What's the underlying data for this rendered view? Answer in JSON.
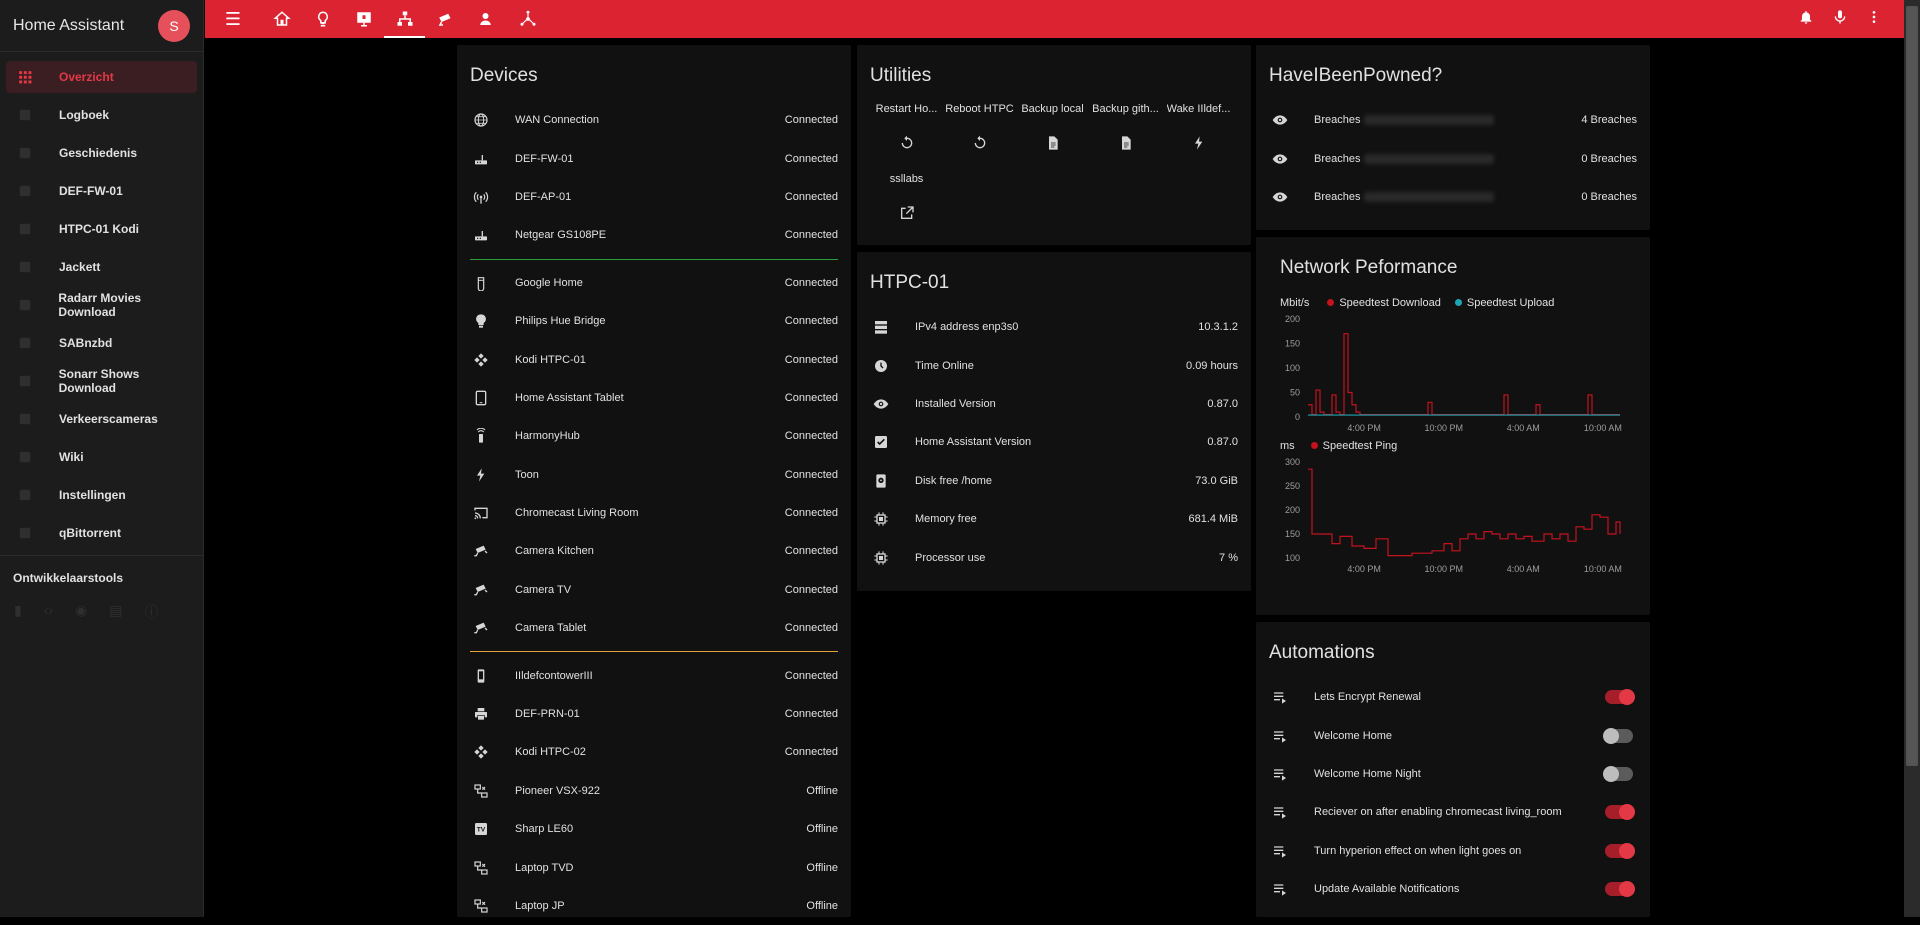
{
  "app": {
    "title": "Home Assistant",
    "avatar_letter": "S"
  },
  "sidebar": {
    "items": [
      {
        "label": "Overzicht",
        "icon": "grid-icon",
        "active": true
      },
      {
        "label": "Logboek",
        "icon": "list-icon"
      },
      {
        "label": "Geschiedenis",
        "icon": "chart-icon"
      },
      {
        "label": "DEF-FW-01",
        "icon": "router-icon"
      },
      {
        "label": "HTPC-01 Kodi",
        "icon": "kodi-icon"
      },
      {
        "label": "Jackett",
        "icon": "bag-icon"
      },
      {
        "label": "Radarr Movies Download",
        "icon": "movie-icon"
      },
      {
        "label": "SABnzbd",
        "icon": "download-icon"
      },
      {
        "label": "Sonarr Shows Download",
        "icon": "tv-icon"
      },
      {
        "label": "Verkeerscameras",
        "icon": "camera-icon"
      },
      {
        "label": "Wiki",
        "icon": "wiki-icon"
      },
      {
        "label": "Instellingen",
        "icon": "gear-icon"
      },
      {
        "label": "qBittorrent",
        "icon": "torrent-icon"
      }
    ],
    "developer_title": "Ontwikkelaarstools"
  },
  "colors": {
    "accent": "#dc2332",
    "toggle_on": "#e33947",
    "download": "#c4131f",
    "upload": "#1ca5b4",
    "green_sep": "#2e9c3a",
    "orange_sep": "#e6a23c"
  },
  "devices": {
    "title": "Devices",
    "groups": [
      [
        {
          "name": "WAN Connection",
          "state": "Connected",
          "icon": "globe-icon"
        },
        {
          "name": "DEF-FW-01",
          "state": "Connected",
          "icon": "router-icon"
        },
        {
          "name": "DEF-AP-01",
          "state": "Connected",
          "icon": "access-point-icon"
        },
        {
          "name": "Netgear GS108PE",
          "state": "Connected",
          "icon": "router-icon"
        }
      ],
      [
        {
          "name": "Google Home",
          "state": "Connected",
          "icon": "speaker-icon"
        },
        {
          "name": "Philips Hue Bridge",
          "state": "Connected",
          "icon": "bulb-icon"
        },
        {
          "name": "Kodi HTPC-01",
          "state": "Connected",
          "icon": "kodi-icon"
        },
        {
          "name": "Home Assistant Tablet",
          "state": "Connected",
          "icon": "tablet-icon"
        },
        {
          "name": "HarmonyHub",
          "state": "Connected",
          "icon": "remote-icon"
        },
        {
          "name": "Toon",
          "state": "Connected",
          "icon": "flash-icon"
        },
        {
          "name": "Chromecast Living Room",
          "state": "Connected",
          "icon": "cast-icon"
        },
        {
          "name": "Camera Kitchen",
          "state": "Connected",
          "icon": "cctv-icon"
        },
        {
          "name": "Camera TV",
          "state": "Connected",
          "icon": "cctv-icon"
        },
        {
          "name": "Camera Tablet",
          "state": "Connected",
          "icon": "cctv-icon"
        }
      ],
      [
        {
          "name": "IIldefcontowerIII",
          "state": "Connected",
          "icon": "cellphone-icon"
        },
        {
          "name": "DEF-PRN-01",
          "state": "Connected",
          "icon": "printer-icon"
        },
        {
          "name": "Kodi HTPC-02",
          "state": "Connected",
          "icon": "kodi-icon"
        },
        {
          "name": "Pioneer VSX-922",
          "state": "Offline",
          "icon": "lan-disconnect-icon"
        },
        {
          "name": "Sharp LE60",
          "state": "Offline",
          "icon": "tv-box-icon"
        },
        {
          "name": "Laptop TVD",
          "state": "Offline",
          "icon": "lan-disconnect-icon"
        },
        {
          "name": "Laptop JP",
          "state": "Offline",
          "icon": "lan-disconnect-icon"
        }
      ]
    ]
  },
  "utilities": {
    "title": "Utilities",
    "items": [
      {
        "label": "Restart Ho...",
        "icon": "restart-icon"
      },
      {
        "label": "Reboot HTPC",
        "icon": "restart-icon"
      },
      {
        "label": "Backup local",
        "icon": "file-icon"
      },
      {
        "label": "Backup gith...",
        "icon": "file-icon"
      },
      {
        "label": "Wake IIldef...",
        "icon": "flash-icon"
      },
      {
        "label": "ssllabs",
        "icon": "open-in-new-icon"
      }
    ]
  },
  "htpc": {
    "title": "HTPC-01",
    "rows": [
      {
        "name": "IPv4 address enp3s0",
        "value": "10.3.1.2",
        "icon": "server-icon"
      },
      {
        "name": "Time Online",
        "value": "0.09 hours",
        "icon": "clock-icon"
      },
      {
        "name": "Installed Version",
        "value": "0.87.0",
        "icon": "eye-icon"
      },
      {
        "name": "Home Assistant Version",
        "value": "0.87.0",
        "icon": "checkbox-icon"
      },
      {
        "name": "Disk free /home",
        "value": "73.0 GiB",
        "icon": "harddisk-icon"
      },
      {
        "name": "Memory free",
        "value": "681.4 MiB",
        "icon": "chip-icon"
      },
      {
        "name": "Processor use",
        "value": "7 %",
        "icon": "chip-icon"
      }
    ]
  },
  "hibp": {
    "title": "HaveIBeenPowned?",
    "rows": [
      {
        "name": "Breaches",
        "value": "4 Breaches",
        "icon": "eye-icon"
      },
      {
        "name": "Breaches",
        "value": "0 Breaches",
        "icon": "eye-icon"
      },
      {
        "name": "Breaches",
        "value": "0 Breaches",
        "icon": "eye-icon"
      }
    ]
  },
  "network": {
    "title": "Network Peformance"
  },
  "chart_data": [
    {
      "type": "line",
      "title": "",
      "ylabel": "Mbit/s",
      "ylim": [
        0,
        200
      ],
      "yticks": [
        0,
        50,
        100,
        150,
        200
      ],
      "xticks": [
        "4:00 PM",
        "10:00 PM",
        "4:00 AM",
        "10:00 AM"
      ],
      "step": true,
      "x": [
        0,
        1,
        2,
        3,
        4,
        5,
        6,
        7,
        8,
        9,
        10,
        11,
        12,
        13,
        14,
        15,
        16,
        17,
        18,
        19,
        20,
        21,
        22,
        23,
        24,
        25,
        26,
        27,
        28,
        29,
        30,
        31,
        32,
        33,
        34,
        35,
        36,
        37,
        38,
        39,
        40,
        41,
        42,
        43,
        44,
        45,
        46,
        47,
        48,
        49,
        50,
        51,
        52,
        53,
        54,
        55,
        56,
        57,
        58,
        59,
        60,
        61,
        62,
        63,
        64,
        65,
        66,
        67,
        68,
        69,
        70,
        71,
        72,
        73,
        74,
        75,
        76,
        77,
        78
      ],
      "series": [
        {
          "name": "Speedtest Download",
          "color": "#c4131f",
          "values": [
            25,
            5,
            55,
            10,
            5,
            5,
            45,
            10,
            5,
            170,
            50,
            25,
            10,
            5,
            5,
            5,
            5,
            5,
            5,
            5,
            5,
            5,
            5,
            5,
            5,
            5,
            5,
            5,
            5,
            5,
            30,
            5,
            5,
            5,
            5,
            5,
            5,
            5,
            5,
            5,
            5,
            5,
            5,
            5,
            5,
            5,
            5,
            5,
            5,
            45,
            5,
            5,
            5,
            5,
            5,
            5,
            5,
            25,
            5,
            5,
            5,
            5,
            5,
            5,
            5,
            5,
            5,
            5,
            5,
            5,
            45,
            5,
            5,
            5,
            5,
            5,
            5,
            5,
            5
          ]
        },
        {
          "name": "Speedtest Upload",
          "color": "#1ca5b4",
          "values": [
            4,
            4,
            4,
            4,
            4,
            4,
            4,
            4,
            4,
            4,
            4,
            4,
            4,
            4,
            4,
            4,
            4,
            4,
            4,
            4,
            4,
            4,
            4,
            4,
            4,
            4,
            4,
            4,
            4,
            4,
            4,
            4,
            4,
            4,
            4,
            4,
            4,
            4,
            4,
            4,
            4,
            4,
            4,
            4,
            4,
            4,
            4,
            4,
            4,
            4,
            4,
            4,
            4,
            4,
            4,
            4,
            4,
            4,
            4,
            4,
            4,
            4,
            4,
            4,
            4,
            4,
            4,
            4,
            4,
            4,
            4,
            4,
            4,
            4,
            4,
            4,
            4,
            4,
            4
          ]
        }
      ]
    },
    {
      "type": "line",
      "title": "",
      "ylabel": "ms",
      "ylim": [
        100,
        300
      ],
      "yticks": [
        100,
        150,
        200,
        250,
        300
      ],
      "xticks": [
        "4:00 PM",
        "10:00 PM",
        "4:00 AM",
        "10:00 AM"
      ],
      "step": true,
      "x": [
        0,
        1,
        2,
        3,
        4,
        5,
        6,
        7,
        8,
        9,
        10,
        11,
        12,
        13,
        14,
        15,
        16,
        17,
        18,
        19,
        20,
        21,
        22,
        23,
        24,
        25,
        26,
        27,
        28,
        29,
        30,
        31,
        32,
        33,
        34,
        35,
        36,
        37,
        38,
        39,
        40,
        41,
        42,
        43,
        44,
        45,
        46,
        47,
        48,
        49,
        50,
        51,
        52,
        53,
        54,
        55,
        56,
        57,
        58,
        59,
        60,
        61,
        62,
        63,
        64,
        65,
        66,
        67,
        68,
        69,
        70,
        71,
        72,
        73,
        74,
        75,
        76,
        77,
        78
      ],
      "series": [
        {
          "name": "Speedtest Ping",
          "color": "#c4131f",
          "values": [
            285,
            150,
            150,
            150,
            150,
            150,
            130,
            130,
            145,
            145,
            145,
            125,
            125,
            125,
            120,
            120,
            120,
            140,
            140,
            140,
            105,
            105,
            105,
            105,
            105,
            105,
            110,
            110,
            110,
            110,
            110,
            115,
            115,
            115,
            130,
            130,
            115,
            115,
            140,
            140,
            150,
            150,
            140,
            140,
            155,
            155,
            150,
            150,
            140,
            140,
            150,
            150,
            140,
            140,
            145,
            145,
            135,
            135,
            135,
            150,
            150,
            140,
            140,
            150,
            150,
            135,
            135,
            165,
            165,
            160,
            160,
            190,
            190,
            185,
            185,
            150,
            150,
            175,
            150
          ]
        }
      ]
    }
  ],
  "automations": {
    "title": "Automations",
    "rows": [
      {
        "name": "Lets Encrypt Renewal",
        "on": true
      },
      {
        "name": "Welcome Home",
        "on": false
      },
      {
        "name": "Welcome Home Night",
        "on": false
      },
      {
        "name": "Reciever on after enabling chromecast living_room",
        "on": true
      },
      {
        "name": "Turn hyperion effect on when light goes on",
        "on": true
      },
      {
        "name": "Update Available Notifications",
        "on": true
      }
    ]
  }
}
